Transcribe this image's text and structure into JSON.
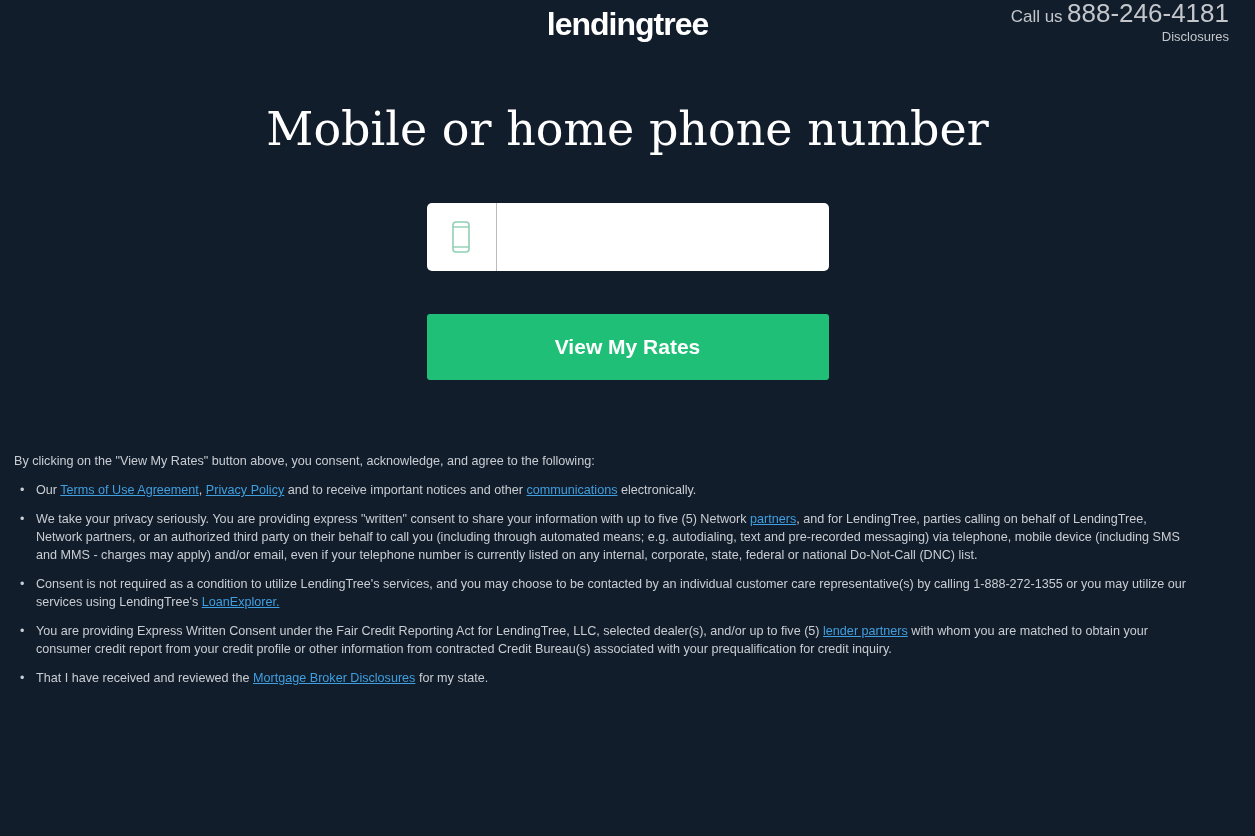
{
  "header": {
    "logo": "lendingtree",
    "call_label": "Call us",
    "phone": "888-246-4181",
    "disclosures_link": "Disclosures"
  },
  "title": "Mobile or home phone number",
  "submit_button": "View My Rates",
  "disclaimer": {
    "intro": "By clicking on the \"View My Rates\" button above, you consent, acknowledge, and agree to the following:",
    "bullets": [
      {
        "marker": "•",
        "parts": [
          {
            "kind": "text",
            "text": "Our "
          },
          {
            "kind": "link",
            "text": "Terms of Use Agreement"
          },
          {
            "kind": "text",
            "text": ", "
          },
          {
            "kind": "link",
            "text": "Privacy Policy"
          },
          {
            "kind": "text",
            "text": " and to receive important notices and other "
          },
          {
            "kind": "link",
            "text": "communications"
          },
          {
            "kind": "text",
            "text": " electronically."
          }
        ]
      },
      {
        "marker": "•",
        "parts": [
          {
            "kind": "text",
            "text": "We take your privacy seriously. You are providing express \"written\" consent to share your information with up to five (5) Network "
          },
          {
            "kind": "link",
            "text": "partners"
          },
          {
            "kind": "text",
            "text": ", and for LendingTree, parties calling on behalf of LendingTree, Network partners, or an authorized third party on their behalf to call you (including through automated means; e.g. autodialing, text and pre-recorded messaging) via telephone, mobile device (including SMS and MMS - charges may apply) and/or email, even if your telephone number is currently listed on any internal, corporate, state, federal or national Do-Not-Call (DNC) list."
          }
        ]
      },
      {
        "marker": "•",
        "parts": [
          {
            "kind": "text",
            "text": "Consent is not required as a condition to utilize LendingTree's services, and you may choose to be contacted by an individual customer care representative(s) by calling 1-888-272-1355 or you may utilize our services using LendingTree's "
          },
          {
            "kind": "link",
            "text": "LoanExplorer."
          }
        ]
      },
      {
        "marker": "•",
        "parts": [
          {
            "kind": "text",
            "text": "You are providing Express Written Consent under the Fair Credit Reporting Act for LendingTree, LLC, selected dealer(s), and/or up to five (5) "
          },
          {
            "kind": "link",
            "text": "lender partners"
          },
          {
            "kind": "text",
            "text": " with whom you are matched to obtain your consumer credit report from your credit profile or other information from contracted Credit Bureau(s) associated with your prequalification for credit inquiry."
          }
        ]
      },
      {
        "marker": "•",
        "parts": [
          {
            "kind": "text",
            "text": "That I have received and reviewed the "
          },
          {
            "kind": "link",
            "text": "Mortgage Broker Disclosures"
          },
          {
            "kind": "text",
            "text": " for my state."
          }
        ]
      }
    ]
  }
}
